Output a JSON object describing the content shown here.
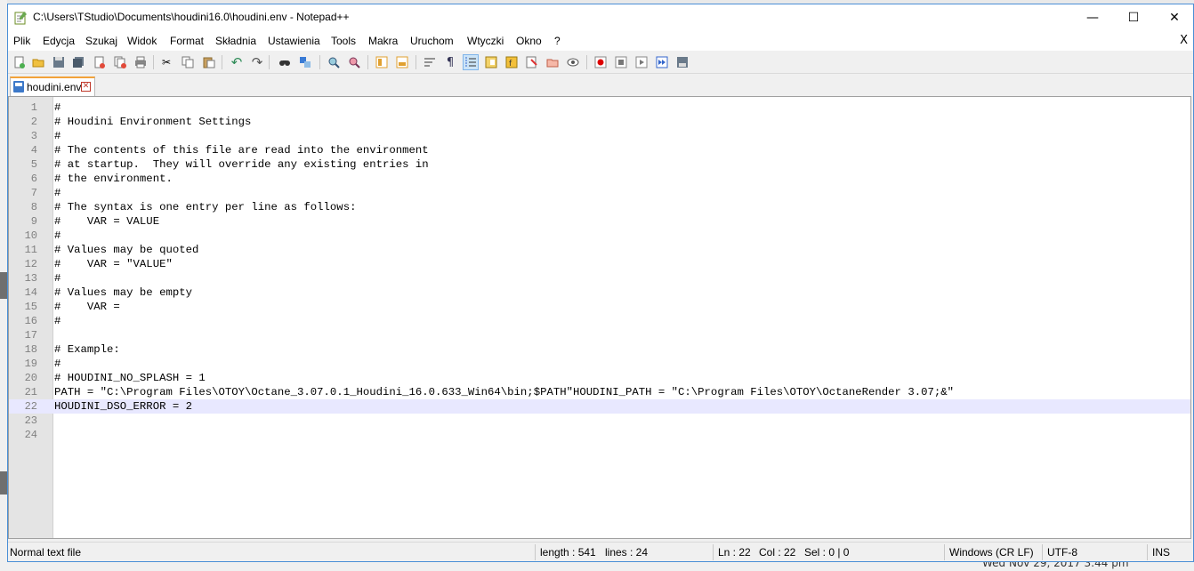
{
  "window": {
    "title": "C:\\Users\\TStudio\\Documents\\houdini16.0\\houdini.env - Notepad++",
    "minimize": "—",
    "maximize": "☐",
    "close": "✕"
  },
  "menu": {
    "items": [
      "Plik",
      "Edycja",
      "Szukaj",
      "Widok",
      "Format",
      "Składnia",
      "Ustawienia",
      "Tools",
      "Makra",
      "Uruchom",
      "Wtyczki",
      "Okno",
      "?"
    ],
    "close": "X"
  },
  "toolbar": {
    "icons": [
      "new-file-icon",
      "open-file-icon",
      "save-icon",
      "save-all-icon",
      "close-icon",
      "close-all-icon",
      "print-icon",
      "cut-icon",
      "copy-icon",
      "paste-icon",
      "undo-icon",
      "redo-icon",
      "find-icon",
      "replace-icon",
      "zoom-in-icon",
      "zoom-out-icon",
      "sync-vertical-icon",
      "sync-horizontal-icon",
      "word-wrap-icon",
      "show-all-chars-icon",
      "indent-guide-icon",
      "document-map-icon",
      "function-list-icon",
      "folder-workspace-icon",
      "monitoring-icon",
      "record-macro-icon",
      "stop-macro-icon",
      "play-macro-icon",
      "run-macro-multiple-icon",
      "save-macro-icon"
    ]
  },
  "tab": {
    "label": "houdini.env",
    "close": "✕"
  },
  "editor": {
    "lines": [
      "#",
      "# Houdini Environment Settings",
      "#",
      "# The contents of this file are read into the environment",
      "# at startup.  They will override any existing entries in",
      "# the environment.",
      "#",
      "# The syntax is one entry per line as follows:",
      "#    VAR = VALUE",
      "#",
      "# Values may be quoted",
      "#    VAR = \"VALUE\"",
      "#",
      "# Values may be empty",
      "#    VAR =",
      "#",
      "",
      "# Example:",
      "#",
      "# HOUDINI_NO_SPLASH = 1",
      "PATH = \"C:\\Program Files\\OTOY\\Octane_3.07.0.1_Houdini_16.0.633_Win64\\bin;$PATH\"HOUDINI_PATH = \"C:\\Program Files\\OTOY\\OctaneRender 3.07;&\"",
      "HOUDINI_DSO_ERROR = 2",
      "",
      ""
    ],
    "current_line": 22
  },
  "status": {
    "file_type": "Normal text file",
    "length": "length : 541",
    "lines": "lines : 24",
    "ln": "Ln : 22",
    "col": "Col : 22",
    "sel": "Sel : 0 | 0",
    "eol": "Windows (CR LF)",
    "encoding": "UTF-8",
    "mode": "INS"
  },
  "background": {
    "clock": "Wed Nov 29, 2017 3:44 pm"
  }
}
